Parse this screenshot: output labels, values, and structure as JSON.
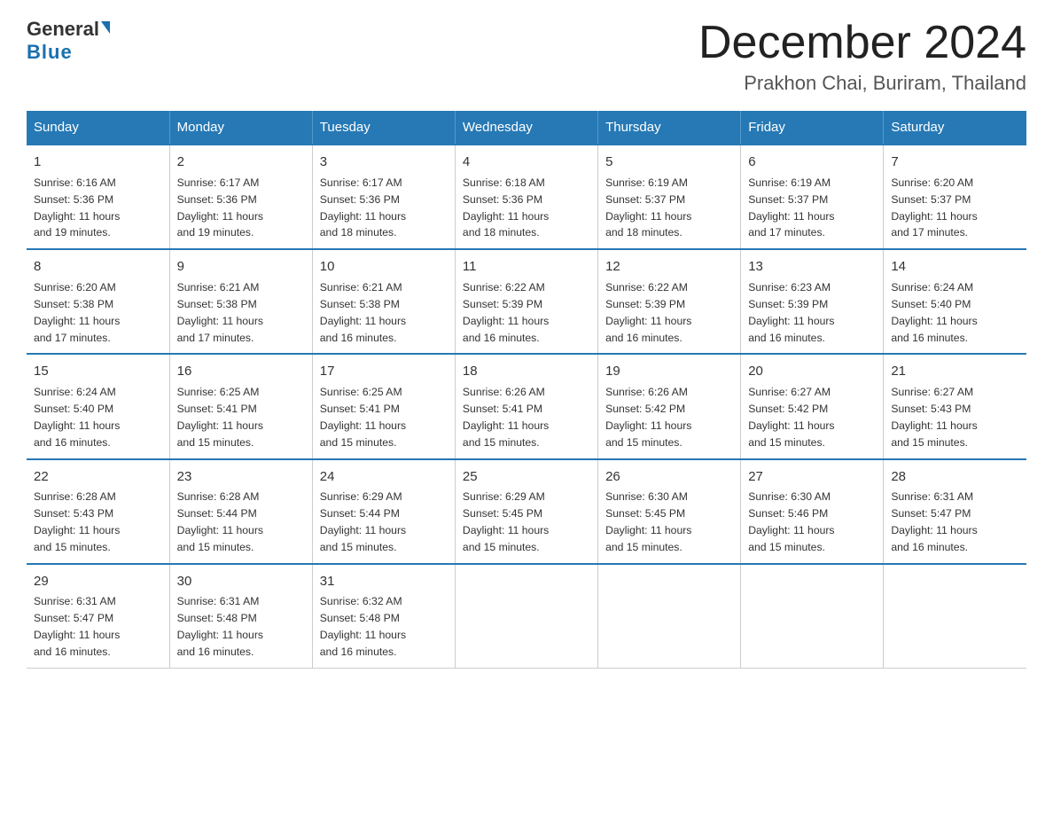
{
  "header": {
    "logo_general": "General",
    "logo_blue": "Blue",
    "month_title": "December 2024",
    "location": "Prakhon Chai, Buriram, Thailand"
  },
  "days_of_week": [
    "Sunday",
    "Monday",
    "Tuesday",
    "Wednesday",
    "Thursday",
    "Friday",
    "Saturday"
  ],
  "weeks": [
    [
      {
        "day": "1",
        "sunrise": "6:16 AM",
        "sunset": "5:36 PM",
        "daylight": "11 hours and 19 minutes."
      },
      {
        "day": "2",
        "sunrise": "6:17 AM",
        "sunset": "5:36 PM",
        "daylight": "11 hours and 19 minutes."
      },
      {
        "day": "3",
        "sunrise": "6:17 AM",
        "sunset": "5:36 PM",
        "daylight": "11 hours and 18 minutes."
      },
      {
        "day": "4",
        "sunrise": "6:18 AM",
        "sunset": "5:36 PM",
        "daylight": "11 hours and 18 minutes."
      },
      {
        "day": "5",
        "sunrise": "6:19 AM",
        "sunset": "5:37 PM",
        "daylight": "11 hours and 18 minutes."
      },
      {
        "day": "6",
        "sunrise": "6:19 AM",
        "sunset": "5:37 PM",
        "daylight": "11 hours and 17 minutes."
      },
      {
        "day": "7",
        "sunrise": "6:20 AM",
        "sunset": "5:37 PM",
        "daylight": "11 hours and 17 minutes."
      }
    ],
    [
      {
        "day": "8",
        "sunrise": "6:20 AM",
        "sunset": "5:38 PM",
        "daylight": "11 hours and 17 minutes."
      },
      {
        "day": "9",
        "sunrise": "6:21 AM",
        "sunset": "5:38 PM",
        "daylight": "11 hours and 17 minutes."
      },
      {
        "day": "10",
        "sunrise": "6:21 AM",
        "sunset": "5:38 PM",
        "daylight": "11 hours and 16 minutes."
      },
      {
        "day": "11",
        "sunrise": "6:22 AM",
        "sunset": "5:39 PM",
        "daylight": "11 hours and 16 minutes."
      },
      {
        "day": "12",
        "sunrise": "6:22 AM",
        "sunset": "5:39 PM",
        "daylight": "11 hours and 16 minutes."
      },
      {
        "day": "13",
        "sunrise": "6:23 AM",
        "sunset": "5:39 PM",
        "daylight": "11 hours and 16 minutes."
      },
      {
        "day": "14",
        "sunrise": "6:24 AM",
        "sunset": "5:40 PM",
        "daylight": "11 hours and 16 minutes."
      }
    ],
    [
      {
        "day": "15",
        "sunrise": "6:24 AM",
        "sunset": "5:40 PM",
        "daylight": "11 hours and 16 minutes."
      },
      {
        "day": "16",
        "sunrise": "6:25 AM",
        "sunset": "5:41 PM",
        "daylight": "11 hours and 15 minutes."
      },
      {
        "day": "17",
        "sunrise": "6:25 AM",
        "sunset": "5:41 PM",
        "daylight": "11 hours and 15 minutes."
      },
      {
        "day": "18",
        "sunrise": "6:26 AM",
        "sunset": "5:41 PM",
        "daylight": "11 hours and 15 minutes."
      },
      {
        "day": "19",
        "sunrise": "6:26 AM",
        "sunset": "5:42 PM",
        "daylight": "11 hours and 15 minutes."
      },
      {
        "day": "20",
        "sunrise": "6:27 AM",
        "sunset": "5:42 PM",
        "daylight": "11 hours and 15 minutes."
      },
      {
        "day": "21",
        "sunrise": "6:27 AM",
        "sunset": "5:43 PM",
        "daylight": "11 hours and 15 minutes."
      }
    ],
    [
      {
        "day": "22",
        "sunrise": "6:28 AM",
        "sunset": "5:43 PM",
        "daylight": "11 hours and 15 minutes."
      },
      {
        "day": "23",
        "sunrise": "6:28 AM",
        "sunset": "5:44 PM",
        "daylight": "11 hours and 15 minutes."
      },
      {
        "day": "24",
        "sunrise": "6:29 AM",
        "sunset": "5:44 PM",
        "daylight": "11 hours and 15 minutes."
      },
      {
        "day": "25",
        "sunrise": "6:29 AM",
        "sunset": "5:45 PM",
        "daylight": "11 hours and 15 minutes."
      },
      {
        "day": "26",
        "sunrise": "6:30 AM",
        "sunset": "5:45 PM",
        "daylight": "11 hours and 15 minutes."
      },
      {
        "day": "27",
        "sunrise": "6:30 AM",
        "sunset": "5:46 PM",
        "daylight": "11 hours and 15 minutes."
      },
      {
        "day": "28",
        "sunrise": "6:31 AM",
        "sunset": "5:47 PM",
        "daylight": "11 hours and 16 minutes."
      }
    ],
    [
      {
        "day": "29",
        "sunrise": "6:31 AM",
        "sunset": "5:47 PM",
        "daylight": "11 hours and 16 minutes."
      },
      {
        "day": "30",
        "sunrise": "6:31 AM",
        "sunset": "5:48 PM",
        "daylight": "11 hours and 16 minutes."
      },
      {
        "day": "31",
        "sunrise": "6:32 AM",
        "sunset": "5:48 PM",
        "daylight": "11 hours and 16 minutes."
      },
      null,
      null,
      null,
      null
    ]
  ],
  "labels": {
    "sunrise": "Sunrise:",
    "sunset": "Sunset:",
    "daylight": "Daylight:"
  }
}
